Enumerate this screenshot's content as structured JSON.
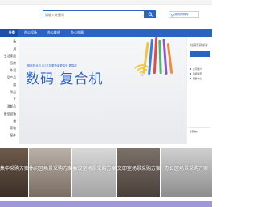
{
  "search": {
    "placeholder": "请输入关键词"
  },
  "cart": {
    "label": "我的购物车"
  },
  "nav": {
    "category_label": "分类",
    "links": [
      "办公设备",
      "办公耗材",
      "办公电器"
    ]
  },
  "sidebar": {
    "items": [
      "备",
      "具",
      "生活家居",
      "厨房",
      "外设",
      "品产品",
      "用",
      "乐品",
      "子",
      "消耗品",
      "备室设备",
      "备",
      "家电",
      "配件"
    ]
  },
  "banner": {
    "subtitle": "数码复合机 | 让打印更简单更高效 更智能",
    "title": "数码 复合机"
  },
  "right_panel": {
    "welcome": "欢迎来到采购商城",
    "lines": [
      "公司简介",
      "新闻资讯",
      "服务中心"
    ],
    "phone_label": "客服热线"
  },
  "tiles": [
    "集中采购方案",
    "休闲区场景采购方案",
    "会议室场景采购方案",
    "文印室场景采购方案",
    "办公区场景采购方案"
  ],
  "colors": {
    "primary": "#2a63c4",
    "nav_dark": "#1b4fa8",
    "bottom": "#9e98d8"
  }
}
